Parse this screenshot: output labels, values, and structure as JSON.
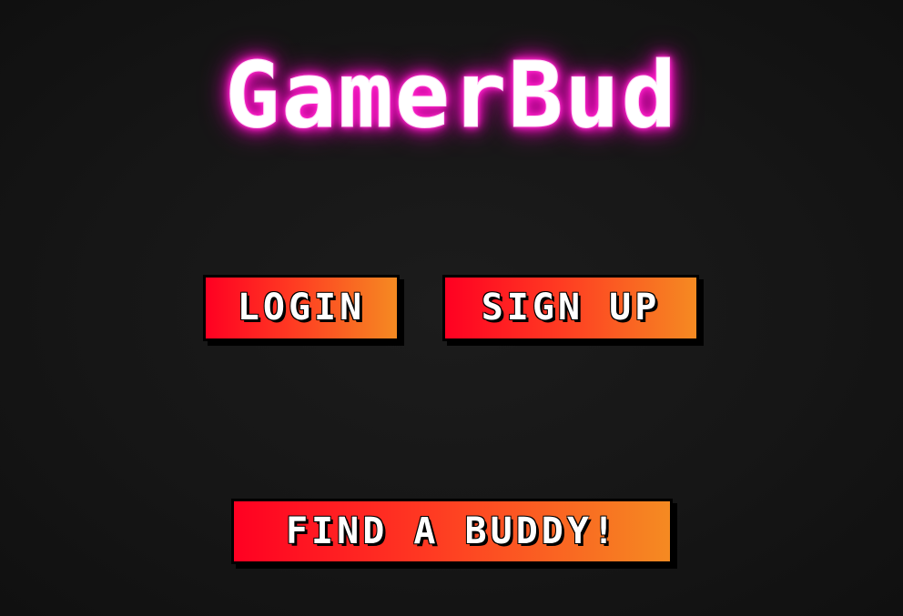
{
  "app": {
    "title": "GamerBud"
  },
  "auth": {
    "login_label": "LOGIN",
    "signup_label": "SIGN UP"
  },
  "cta": {
    "find_label": "FIND A BUDDY!"
  },
  "colors": {
    "background": "#161616",
    "title_glow": "#ff1fc8",
    "button_gradient_start": "#ff0022",
    "button_gradient_end": "#f58a22",
    "button_text": "#ffffff",
    "button_outline": "#000000"
  }
}
